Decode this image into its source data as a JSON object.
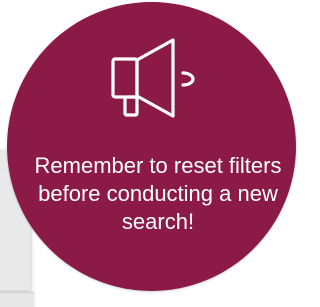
{
  "notice": {
    "message": "Remember to reset filters before conducting a new search!",
    "icon": "megaphone-icon",
    "background_color": "#8b1a47",
    "foreground_color": "#ffffff"
  }
}
